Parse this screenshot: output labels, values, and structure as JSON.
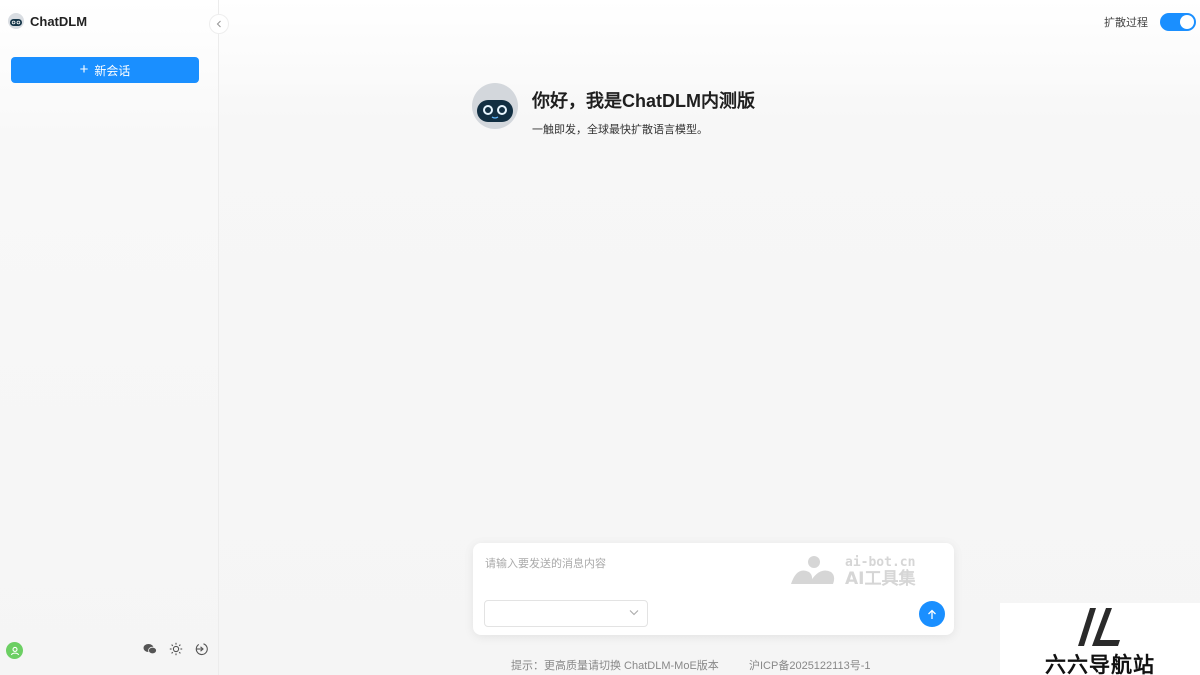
{
  "app": {
    "name": "ChatDLM"
  },
  "sidebar": {
    "new_chat_label": "新会话"
  },
  "header": {
    "toggle_label": "扩散过程",
    "toggle_on": true
  },
  "welcome": {
    "title": "你好，我是ChatDLM内测版",
    "subtitle": "一触即发，全球最快扩散语言模型。"
  },
  "composer": {
    "placeholder": "请输入要发送的消息内容",
    "watermark_domain": "ai-bot.cn",
    "watermark_name": "AI工具集",
    "model_select_value": ""
  },
  "footer": {
    "hint": "提示：更高质量请切换 ChatDLM-MoE版本",
    "icp": "沪ICP备2025122113号-1"
  },
  "overlay": {
    "brand_text": "六六导航站"
  },
  "colors": {
    "accent": "#1a8fff",
    "avatar": "#6ccf63"
  },
  "icons": [
    "robot-icon",
    "chevron-left-icon",
    "plus-icon",
    "user-icon",
    "wechat-icon",
    "sun-icon",
    "logout-icon",
    "chevron-down-icon",
    "arrow-up-icon"
  ]
}
